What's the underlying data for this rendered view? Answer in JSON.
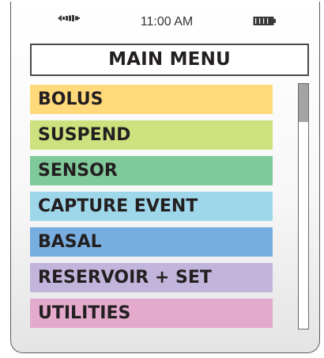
{
  "status_bar": {
    "signal_icon": "signal-icon",
    "time": "11:00 AM",
    "battery_icon": "battery-icon"
  },
  "title": "MAIN MENU",
  "menu": {
    "items": [
      {
        "label": "BOLUS",
        "color": "#ffd97a"
      },
      {
        "label": "SUSPEND",
        "color": "#cde27e"
      },
      {
        "label": "SENSOR",
        "color": "#80c99b"
      },
      {
        "label": "CAPTURE EVENT",
        "color": "#9ed7ea"
      },
      {
        "label": "BASAL",
        "color": "#78aedf"
      },
      {
        "label": "RESERVOIR + SET",
        "color": "#c2b5db"
      },
      {
        "label": "UTILITIES",
        "color": "#e3aacc"
      }
    ]
  },
  "scrollbar": {
    "position": 0
  }
}
